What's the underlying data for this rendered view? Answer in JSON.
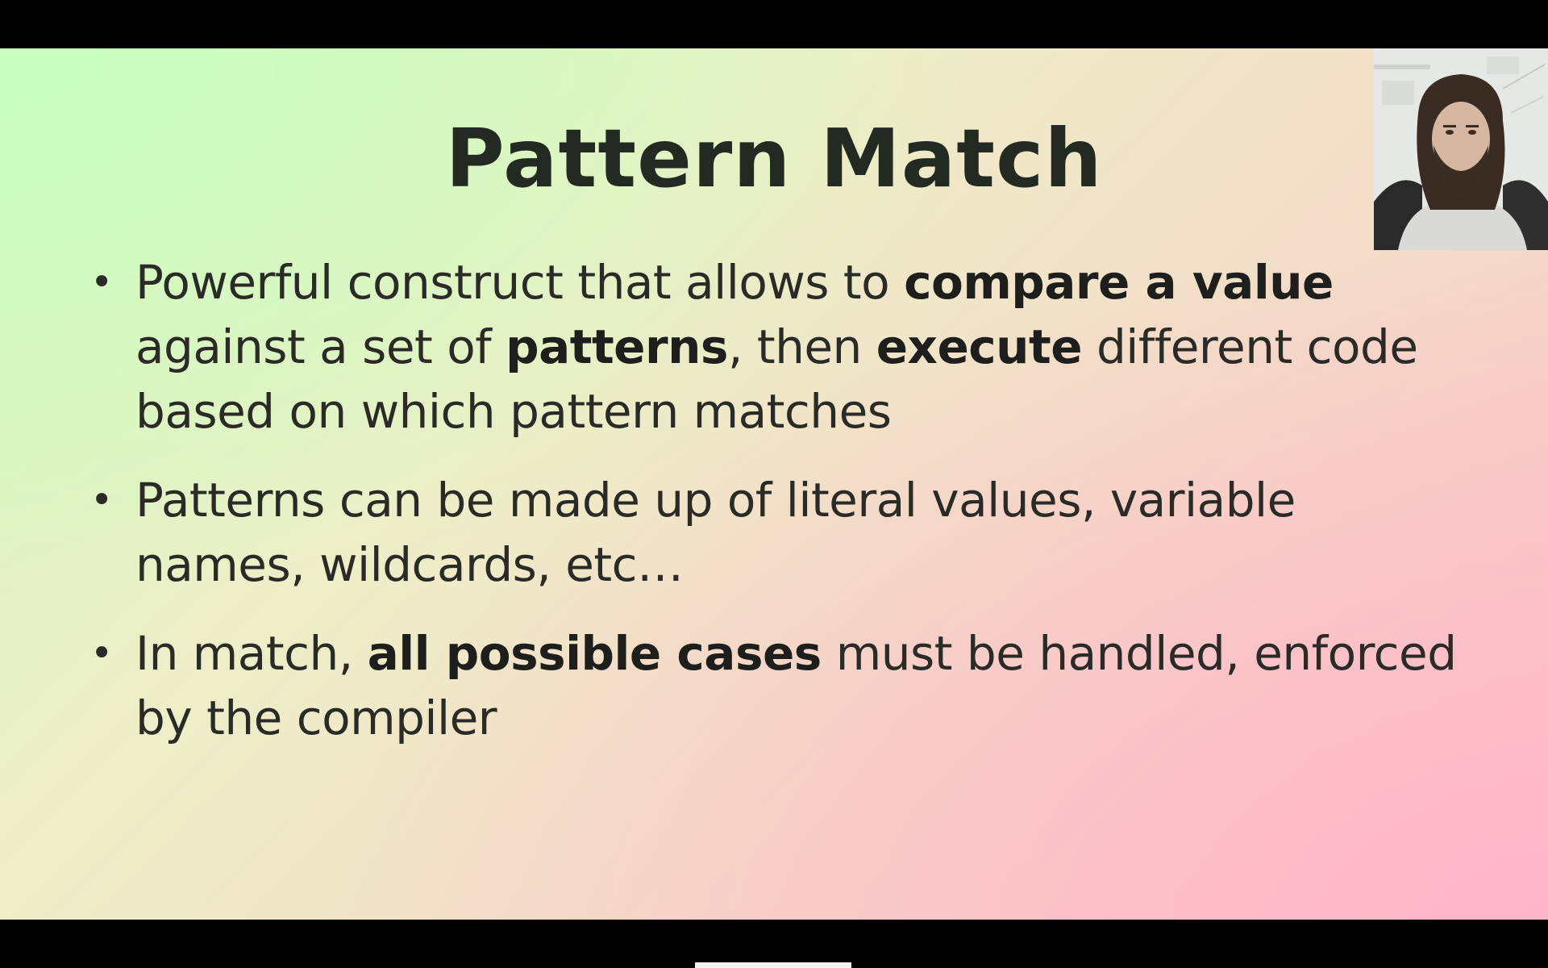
{
  "slide": {
    "title": "Pattern Match",
    "bullets": [
      {
        "parts": [
          {
            "text": "Powerful construct that allows to ",
            "bold": false
          },
          {
            "text": "compare a value",
            "bold": true
          },
          {
            "text": " against a set of ",
            "bold": false
          },
          {
            "text": "patterns",
            "bold": true
          },
          {
            "text": ", then ",
            "bold": false
          },
          {
            "text": "execute",
            "bold": true
          },
          {
            "text": " different code based on which pattern matches",
            "bold": false
          }
        ]
      },
      {
        "parts": [
          {
            "text": "Patterns can be made up of literal values, variable names, wildcards, etc…",
            "bold": false
          }
        ]
      },
      {
        "parts": [
          {
            "text": "In match, ",
            "bold": false
          },
          {
            "text": "all possible cases",
            "bold": true
          },
          {
            "text": " must be handled, enforced by the compiler",
            "bold": false
          }
        ]
      }
    ]
  },
  "webcam": {
    "icon": "presenter-webcam-video"
  },
  "player": {
    "progress": 1.0
  },
  "colors": {
    "text": "#2a2a26",
    "title": "#222a22",
    "gradient_start": "#d6f7c0",
    "gradient_end": "#fbc4c8"
  }
}
